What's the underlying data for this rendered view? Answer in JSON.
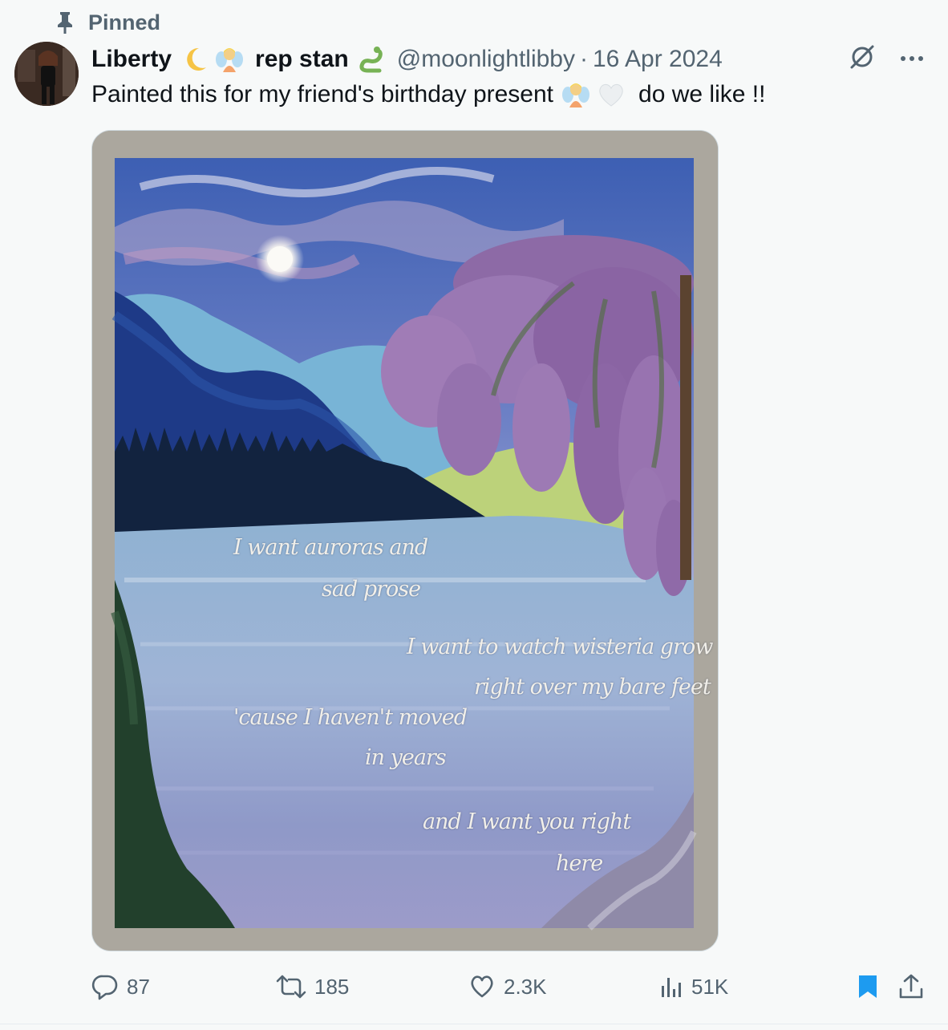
{
  "pinned": {
    "label": "Pinned"
  },
  "author": {
    "display_name": "Liberty",
    "name_emoji_1": "crescent-moon",
    "name_emoji_2": "fairy",
    "display_name_suffix": "rep stan",
    "name_emoji_3": "snake",
    "handle": "@moonlightlibby",
    "separator": "·",
    "date": "16 Apr 2024"
  },
  "post": {
    "text_before": "Painted this for my friend's birthday present",
    "text_emoji_1": "fairy",
    "text_emoji_2": "white-heart",
    "text_after": "do we like !!"
  },
  "painting": {
    "lyrics": [
      "I want auroras and",
      "sad prose",
      "I want to watch wisteria grow",
      "right over my bare feet",
      "'cause I haven't moved",
      "in years",
      "and I want you right",
      "here"
    ]
  },
  "actions": {
    "replies": "87",
    "reposts": "185",
    "likes": "2.3K",
    "views": "51K",
    "bookmarked": true
  },
  "colors": {
    "muted": "#536471",
    "bookmark_active": "#1d9bf0",
    "background": "#f7f9f9"
  }
}
